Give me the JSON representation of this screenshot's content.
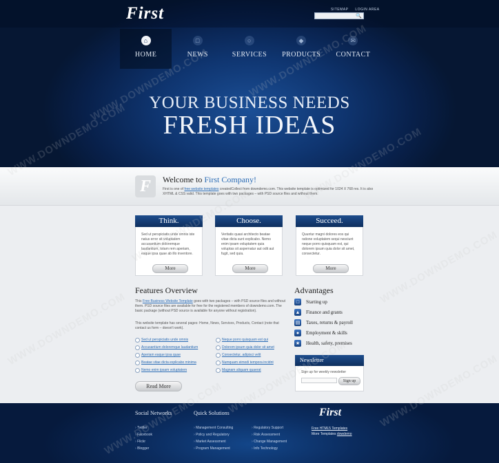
{
  "header": {
    "logo": "First",
    "top_links": [
      "SITEMAP",
      "LOGIN AREA"
    ],
    "search_placeholder": "",
    "nav": [
      {
        "label": "HOME",
        "icon": "home-icon",
        "active": true
      },
      {
        "label": "NEWS",
        "icon": "news-icon",
        "active": false
      },
      {
        "label": "SERVICES",
        "icon": "services-icon",
        "active": false
      },
      {
        "label": "PRODUCTS",
        "icon": "products-icon",
        "active": false
      },
      {
        "label": "CONTACT",
        "icon": "contact-icon",
        "active": false
      }
    ],
    "hero_line1": "YOUR BUSINESS NEEDS",
    "hero_line2": "FRESH IDEAS"
  },
  "welcome": {
    "title_prefix": "Welcome to ",
    "title_accent": "First Company!",
    "text_before_link": "First is one of ",
    "link": "free website templates",
    "text_after_link": " createdCollect from downdemo.com. This website template is optimized for 1024 X 768 res. It is also XHTML & CSS valid. This template goes with two packages – with PSD source files and without them."
  },
  "boxes": [
    {
      "title": "Think.",
      "text": "Sed ut perspiciatis unde omnis iste natus error sit voluptatem accusantium doloremque laudantium, totam rem aperiam, eaque ipsa quae ab illo inventore.",
      "button": "More"
    },
    {
      "title": "Choose.",
      "text": "Veritatis quasi architecto beatae vitae dicta sunt explicabo. Nemo enim ipsam voluptatem quia voluptas sit aspernatur aut odit aut fugit, sed quia.",
      "button": "More"
    },
    {
      "title": "Succeed.",
      "text": "Quuntur magni dolores eos qui ratione voluptatem sequi nesciunt neque porro quisquam est, qui dolorem ipsum quia dolor sit amet, consectetur.",
      "button": "More"
    }
  ],
  "features": {
    "title": "Features Overview",
    "para1_before": "This ",
    "para1_link": "Free Business Website Template",
    "para1_after": " goes with two packages – with PSD source files and without them. PSD source files are available for free for the registered members of downdemo.com. The basic package (without PSD source is available for anyone without registration).",
    "para2": "This website template has several pages: Home, News, Services, Products, Contact (note that contact us form – doesn't work).",
    "links_left": [
      "Sed ut perspiciatis unde omnis",
      "Accusantium doloremque laudantium",
      "Aperiam eaque ipsa quae",
      "Beatae vitae dicta explicabo minima",
      "Nemo enim ipsam voluptatem"
    ],
    "links_right": [
      "Neque porro quisquam est qui",
      "Dolorem ipsum quia dolor sit amet",
      "Consectetur, adipisci velit",
      "Numquam eimodi tempora incidnt",
      "Magnam aliquam quaerat"
    ],
    "button": "Read More"
  },
  "advantages": {
    "title": "Advantages",
    "items": [
      {
        "label": "Starting up",
        "icon": "folder-icon"
      },
      {
        "label": "Finance and grants",
        "icon": "chart-icon"
      },
      {
        "label": "Taxes, returns & payroll",
        "icon": "document-icon"
      },
      {
        "label": "Employment & skills",
        "icon": "people-icon"
      },
      {
        "label": "Health, safety, premises",
        "icon": "star-icon"
      }
    ]
  },
  "newsletter": {
    "title": "Newsletter",
    "label": "Sign up for weekly newsletter",
    "button": "Sign up"
  },
  "footer": {
    "social_title": "Social Networks",
    "social_links": [
      "Twitter",
      "Facebook",
      "Flickr",
      "Blogger"
    ],
    "solutions_title": "Quick Solutions",
    "solutions_col1": [
      "Management Consulting",
      "Policy and Regulatory",
      "Market Assessment",
      "Program Management"
    ],
    "solutions_col2": [
      "Regulatory Support",
      "Risk Assessment",
      "Change Management",
      "Info Technology"
    ],
    "logo": "First",
    "right_link": "Free HTML5 Templates",
    "right_text_before": "More Templates ",
    "right_text_link": "dowdemo"
  },
  "watermark": "WWW.DOWNDEMO.COM"
}
